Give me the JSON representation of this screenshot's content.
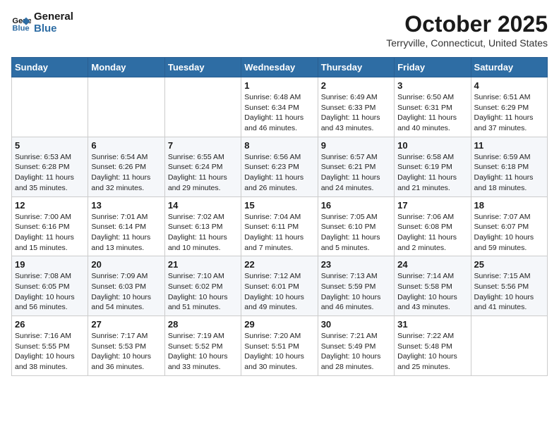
{
  "header": {
    "logo_general": "General",
    "logo_blue": "Blue",
    "month": "October 2025",
    "location": "Terryville, Connecticut, United States"
  },
  "days_of_week": [
    "Sunday",
    "Monday",
    "Tuesday",
    "Wednesday",
    "Thursday",
    "Friday",
    "Saturday"
  ],
  "weeks": [
    [
      {
        "day": "",
        "info": ""
      },
      {
        "day": "",
        "info": ""
      },
      {
        "day": "",
        "info": ""
      },
      {
        "day": "1",
        "info": "Sunrise: 6:48 AM\nSunset: 6:34 PM\nDaylight: 11 hours and 46 minutes."
      },
      {
        "day": "2",
        "info": "Sunrise: 6:49 AM\nSunset: 6:33 PM\nDaylight: 11 hours and 43 minutes."
      },
      {
        "day": "3",
        "info": "Sunrise: 6:50 AM\nSunset: 6:31 PM\nDaylight: 11 hours and 40 minutes."
      },
      {
        "day": "4",
        "info": "Sunrise: 6:51 AM\nSunset: 6:29 PM\nDaylight: 11 hours and 37 minutes."
      }
    ],
    [
      {
        "day": "5",
        "info": "Sunrise: 6:53 AM\nSunset: 6:28 PM\nDaylight: 11 hours and 35 minutes."
      },
      {
        "day": "6",
        "info": "Sunrise: 6:54 AM\nSunset: 6:26 PM\nDaylight: 11 hours and 32 minutes."
      },
      {
        "day": "7",
        "info": "Sunrise: 6:55 AM\nSunset: 6:24 PM\nDaylight: 11 hours and 29 minutes."
      },
      {
        "day": "8",
        "info": "Sunrise: 6:56 AM\nSunset: 6:23 PM\nDaylight: 11 hours and 26 minutes."
      },
      {
        "day": "9",
        "info": "Sunrise: 6:57 AM\nSunset: 6:21 PM\nDaylight: 11 hours and 24 minutes."
      },
      {
        "day": "10",
        "info": "Sunrise: 6:58 AM\nSunset: 6:19 PM\nDaylight: 11 hours and 21 minutes."
      },
      {
        "day": "11",
        "info": "Sunrise: 6:59 AM\nSunset: 6:18 PM\nDaylight: 11 hours and 18 minutes."
      }
    ],
    [
      {
        "day": "12",
        "info": "Sunrise: 7:00 AM\nSunset: 6:16 PM\nDaylight: 11 hours and 15 minutes."
      },
      {
        "day": "13",
        "info": "Sunrise: 7:01 AM\nSunset: 6:14 PM\nDaylight: 11 hours and 13 minutes."
      },
      {
        "day": "14",
        "info": "Sunrise: 7:02 AM\nSunset: 6:13 PM\nDaylight: 11 hours and 10 minutes."
      },
      {
        "day": "15",
        "info": "Sunrise: 7:04 AM\nSunset: 6:11 PM\nDaylight: 11 hours and 7 minutes."
      },
      {
        "day": "16",
        "info": "Sunrise: 7:05 AM\nSunset: 6:10 PM\nDaylight: 11 hours and 5 minutes."
      },
      {
        "day": "17",
        "info": "Sunrise: 7:06 AM\nSunset: 6:08 PM\nDaylight: 11 hours and 2 minutes."
      },
      {
        "day": "18",
        "info": "Sunrise: 7:07 AM\nSunset: 6:07 PM\nDaylight: 10 hours and 59 minutes."
      }
    ],
    [
      {
        "day": "19",
        "info": "Sunrise: 7:08 AM\nSunset: 6:05 PM\nDaylight: 10 hours and 56 minutes."
      },
      {
        "day": "20",
        "info": "Sunrise: 7:09 AM\nSunset: 6:03 PM\nDaylight: 10 hours and 54 minutes."
      },
      {
        "day": "21",
        "info": "Sunrise: 7:10 AM\nSunset: 6:02 PM\nDaylight: 10 hours and 51 minutes."
      },
      {
        "day": "22",
        "info": "Sunrise: 7:12 AM\nSunset: 6:01 PM\nDaylight: 10 hours and 49 minutes."
      },
      {
        "day": "23",
        "info": "Sunrise: 7:13 AM\nSunset: 5:59 PM\nDaylight: 10 hours and 46 minutes."
      },
      {
        "day": "24",
        "info": "Sunrise: 7:14 AM\nSunset: 5:58 PM\nDaylight: 10 hours and 43 minutes."
      },
      {
        "day": "25",
        "info": "Sunrise: 7:15 AM\nSunset: 5:56 PM\nDaylight: 10 hours and 41 minutes."
      }
    ],
    [
      {
        "day": "26",
        "info": "Sunrise: 7:16 AM\nSunset: 5:55 PM\nDaylight: 10 hours and 38 minutes."
      },
      {
        "day": "27",
        "info": "Sunrise: 7:17 AM\nSunset: 5:53 PM\nDaylight: 10 hours and 36 minutes."
      },
      {
        "day": "28",
        "info": "Sunrise: 7:19 AM\nSunset: 5:52 PM\nDaylight: 10 hours and 33 minutes."
      },
      {
        "day": "29",
        "info": "Sunrise: 7:20 AM\nSunset: 5:51 PM\nDaylight: 10 hours and 30 minutes."
      },
      {
        "day": "30",
        "info": "Sunrise: 7:21 AM\nSunset: 5:49 PM\nDaylight: 10 hours and 28 minutes."
      },
      {
        "day": "31",
        "info": "Sunrise: 7:22 AM\nSunset: 5:48 PM\nDaylight: 10 hours and 25 minutes."
      },
      {
        "day": "",
        "info": ""
      }
    ]
  ]
}
